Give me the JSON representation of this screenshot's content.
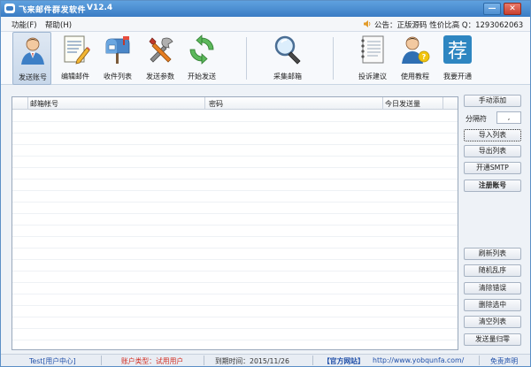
{
  "window": {
    "title": "飞来邮件群发软件",
    "version": "V12.4",
    "minimize": "—",
    "close": "✕"
  },
  "menu": {
    "func": "功能(F)",
    "help": "帮助(H)"
  },
  "notice": {
    "text": "公告：正版源码 性价比高 Q：1293062063"
  },
  "toolbar": {
    "send_account": "发送账号",
    "edit_mail": "编辑邮件",
    "recv_list": "收件列表",
    "send_params": "发送参数",
    "start_send": "开始发送",
    "collect_mail": "采集邮箱",
    "feedback": "投诉建议",
    "tutorial": "使用教程",
    "open_service": "我要开通",
    "open_service_glyph": "荐"
  },
  "list": {
    "columns": [
      "邮箱帐号",
      "密码",
      "今日发送量"
    ]
  },
  "side": {
    "manual_add": "手动添加",
    "separator_label": "分隔符",
    "separator_value": ",",
    "import_list": "导入列表",
    "export_list": "导出列表",
    "open_smtp": "开通SMTP",
    "register": "注册账号",
    "refresh": "刷新列表",
    "shuffle": "随机乱序",
    "clear_errors": "清除错误",
    "delete_selected": "删除选中",
    "clear_list": "清空列表",
    "reset_count": "发送量归零"
  },
  "status": {
    "user": "Test[用户中心]",
    "account_type": "账户类型：试用用户",
    "expire": "到期时间：2015/11/26",
    "official_site": "【官方网站】",
    "url": "http://www.yobqunfa.com/",
    "disclaimer": "免责声明"
  }
}
